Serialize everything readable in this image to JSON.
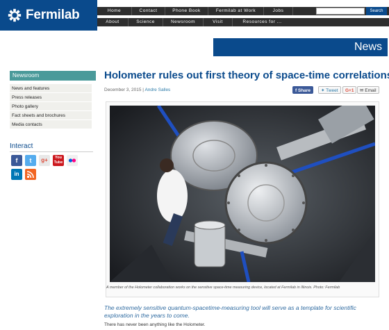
{
  "header": {
    "logo_text": "Fermilab",
    "nav_top": [
      "Home",
      "Contact",
      "Phone Book",
      "Fermilab at Work",
      "Jobs"
    ],
    "nav_bottom": [
      "About",
      "Science",
      "Newsroom",
      "Visit",
      "Resources for ..."
    ],
    "search_button": "Search"
  },
  "banner": {
    "label": "News"
  },
  "sidebar": {
    "heading": "Newsroom",
    "items": [
      "News and features",
      "Press releases",
      "Photo gallery",
      "Fact sheets and brochures",
      "Media contacts"
    ],
    "interact_title": "Interact",
    "social": [
      {
        "icon": "facebook-icon",
        "glyph": "f"
      },
      {
        "icon": "twitter-icon",
        "glyph": "t"
      },
      {
        "icon": "googleplus-icon",
        "glyph": "g+"
      },
      {
        "icon": "youtube-icon",
        "glyph": "You Tube"
      },
      {
        "icon": "flickr-icon",
        "glyph": "●●"
      },
      {
        "icon": "linkedin-icon",
        "glyph": "in"
      },
      {
        "icon": "rss-icon",
        "glyph": "◢"
      }
    ]
  },
  "article": {
    "title": "Holometer rules out first theory of space-time correlations",
    "date": "December 3, 2015",
    "separator": "|",
    "author": "Andre Salles",
    "share": {
      "facebook": "Share",
      "twitter": "Tweet",
      "googleplus": "G+1",
      "email": "Email"
    },
    "caption": "A member of the Holometer collaboration works on the sensitive space-time measuring device, located at Fermilab in Illinois. Photo: Fermilab",
    "lead": "The extremely sensitive quantum-spacetime-measuring tool will serve as a template for scientific exploration in the years to come.",
    "body": "There has never been anything like the Holometer."
  },
  "colors": {
    "brand_blue": "#0a4a8c",
    "sidebar_teal": "#4a9a9a",
    "nav_dark": "#2e2e2e",
    "lead_blue": "#2e6aa0"
  }
}
